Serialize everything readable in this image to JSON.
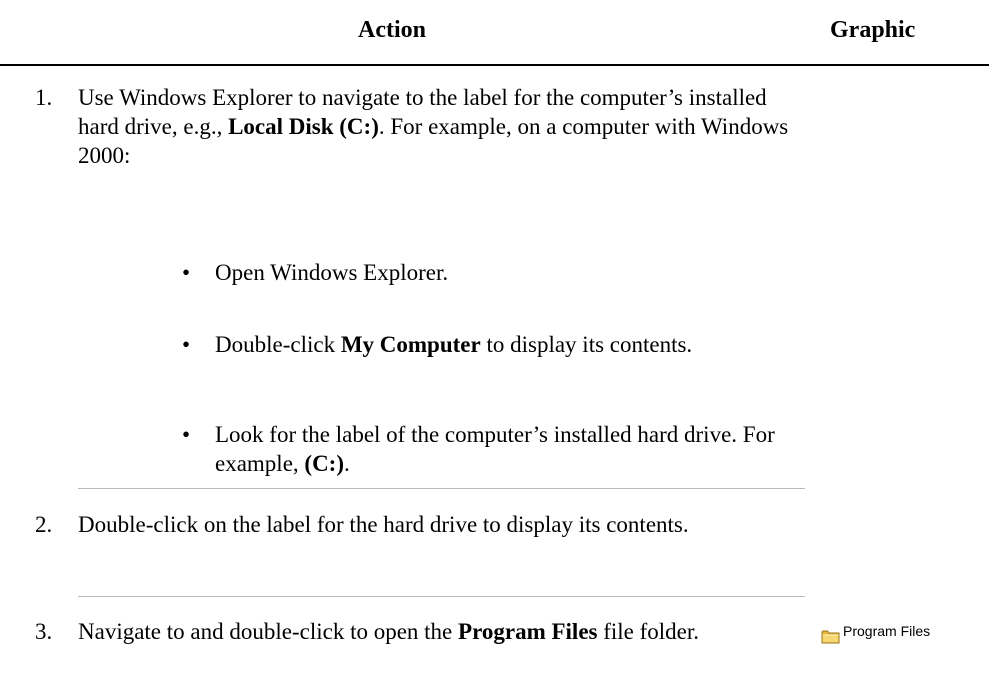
{
  "columns": {
    "action": "Action",
    "graphic": "Graphic"
  },
  "steps": [
    {
      "number": "1.",
      "text_parts": [
        "Use Windows Explorer to navigate to the label for the computer’s installed hard drive, e.g., ",
        "Local Disk (C:)",
        ". For example, on a computer with Windows 2000:"
      ],
      "bullets": [
        {
          "parts": [
            "Open Windows Explorer."
          ]
        },
        {
          "parts": [
            "Double-click ",
            "My Computer",
            " to display its contents."
          ]
        },
        {
          "parts": [
            "Look for the label of the computer’s installed hard drive.  For example, ",
            "(C:)",
            "."
          ]
        }
      ]
    },
    {
      "number": "2.",
      "text_parts": [
        "Double-click on the label for the hard drive to display its contents."
      ]
    },
    {
      "number": "3.",
      "text_parts": [
        "Navigate to and double-click to open the ",
        "Program Files",
        " file folder."
      ],
      "graphic": {
        "icon": "folder-icon",
        "label": "Program Files",
        "icon_color": "#f2c94c"
      }
    }
  ]
}
